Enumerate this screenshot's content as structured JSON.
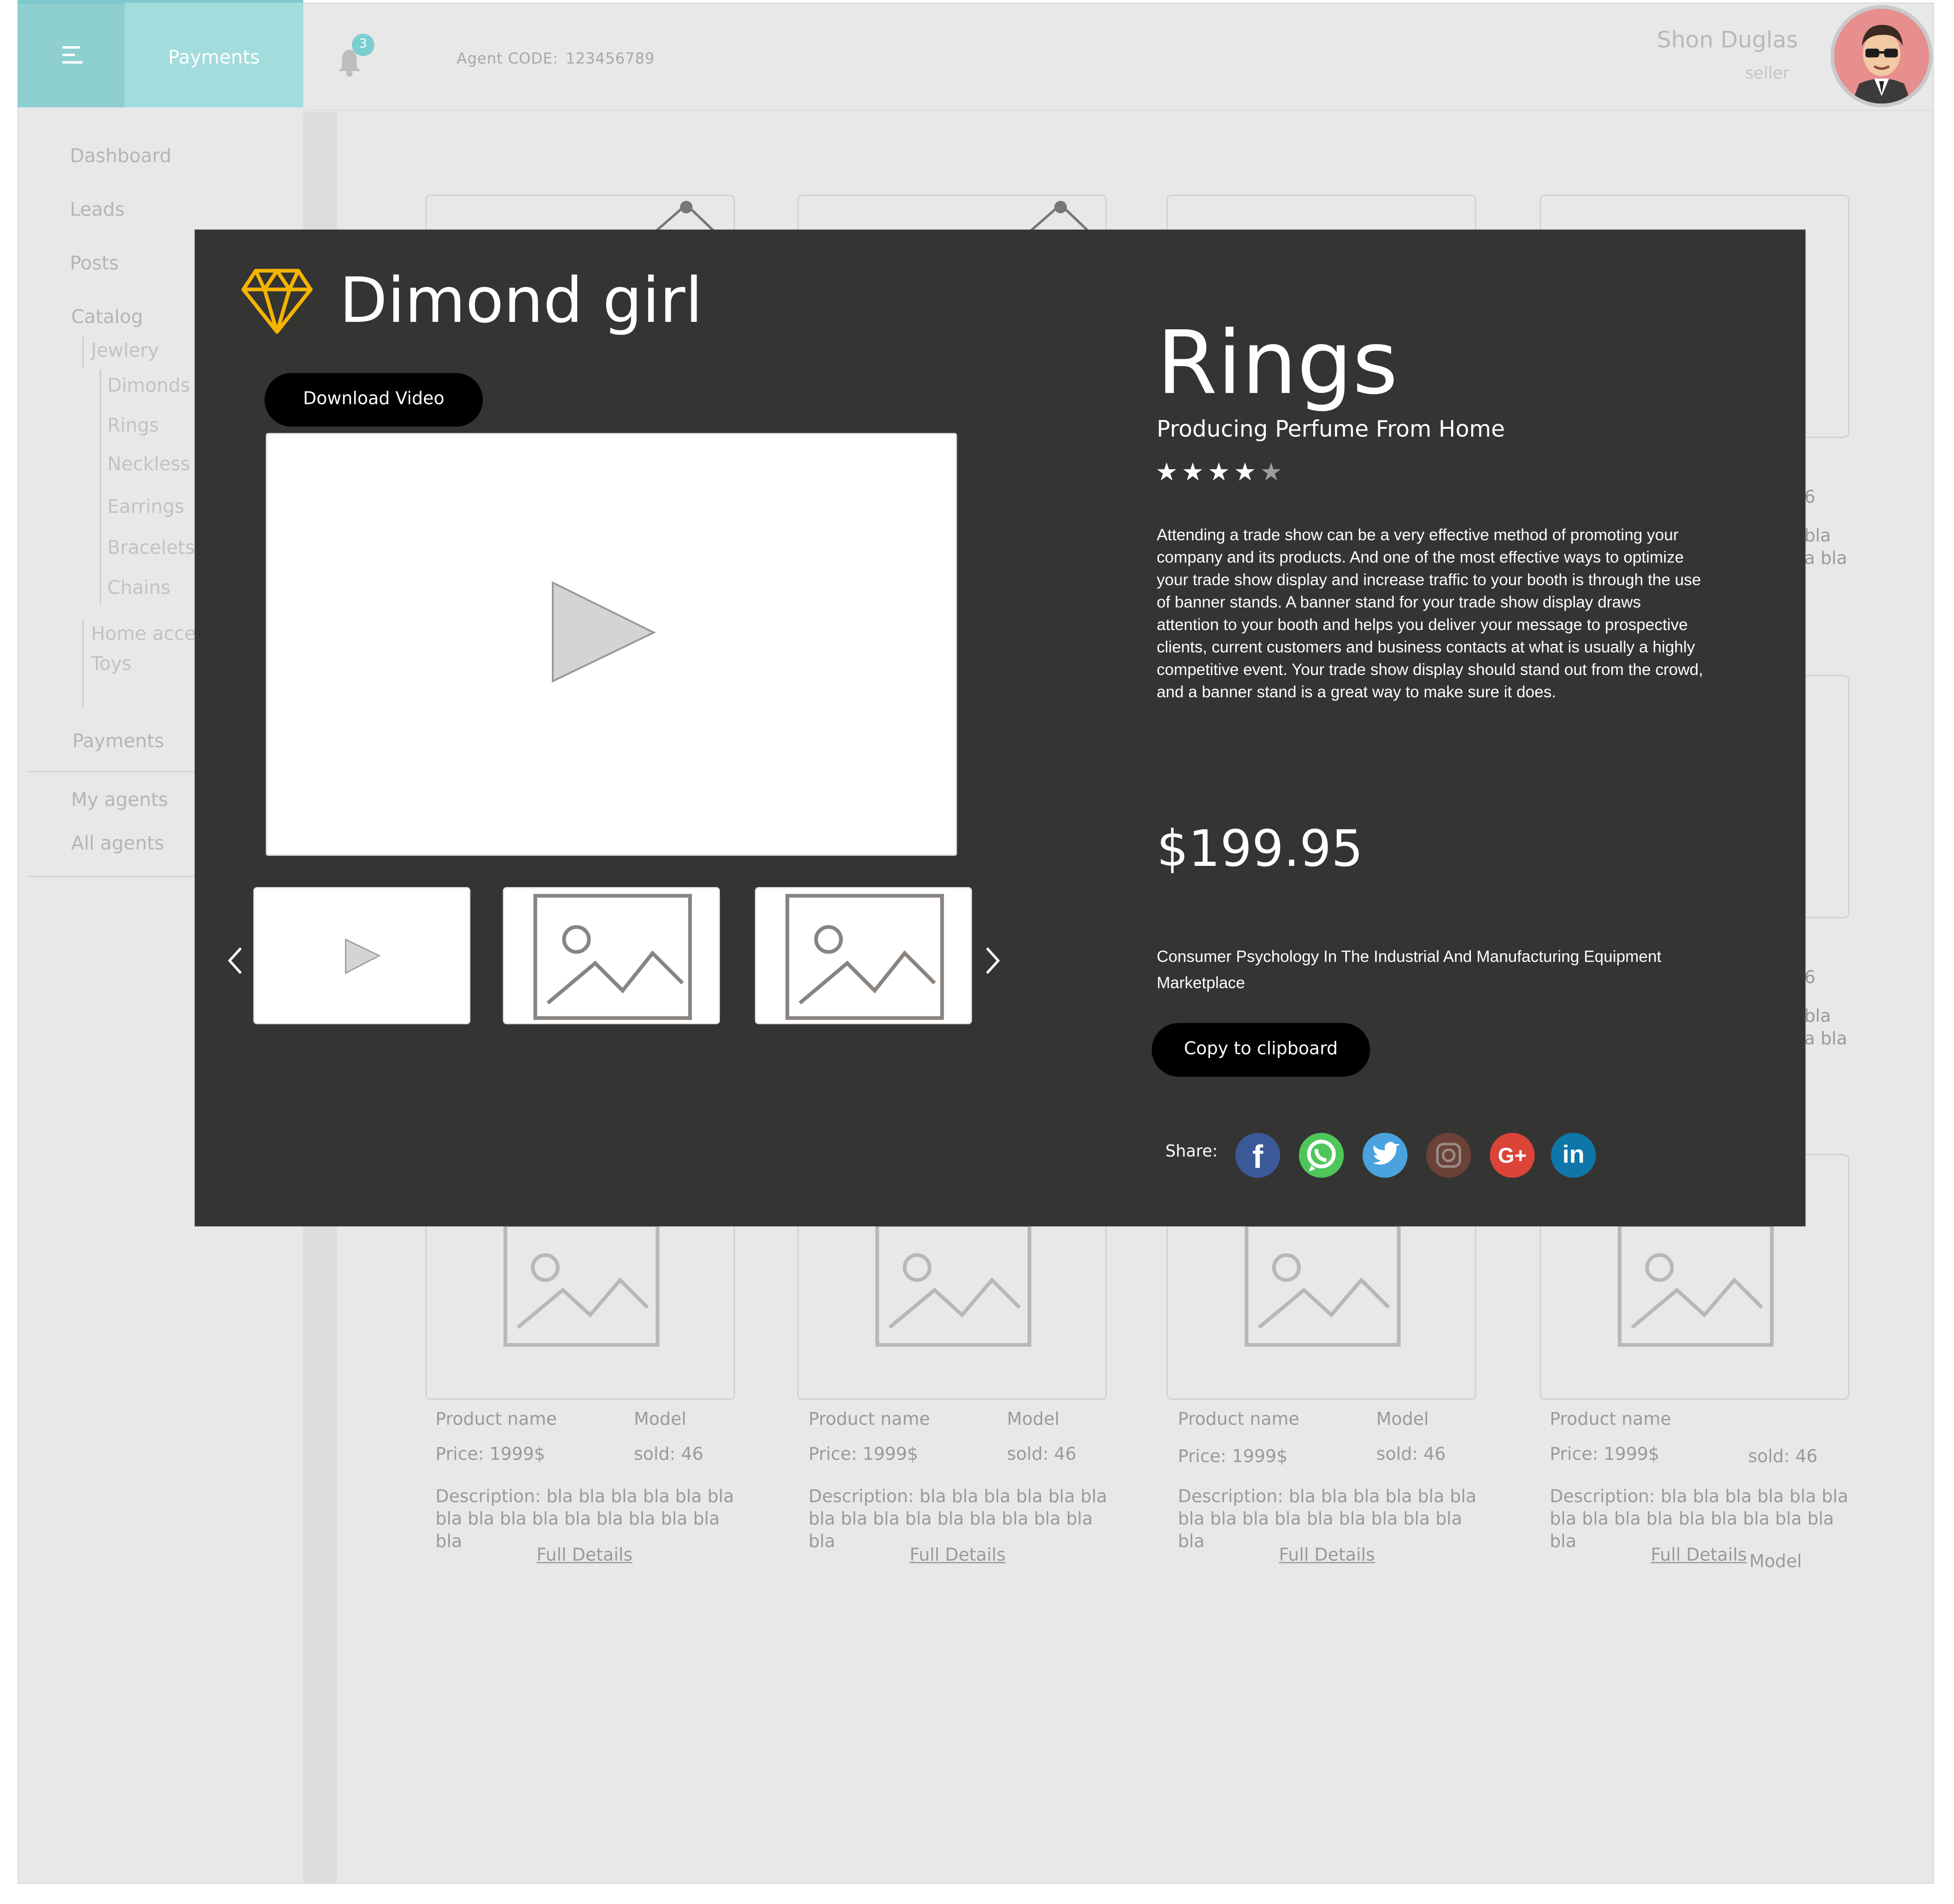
{
  "header": {
    "nav_label": "Payments",
    "notification_count": "3",
    "agent_label": "Agent  CODE:",
    "agent_code": "123456789",
    "user_name": "Shon Duglas",
    "user_role": "seller"
  },
  "sidebar": {
    "dashboard": "Dashboard",
    "leads": "Leads",
    "posts": "Posts",
    "catalog": "Catalog",
    "jewelry": "Jewlery",
    "dimonds": "Dimonds",
    "rings": "Rings",
    "neckless": "Neckless",
    "earrings": "Earrings",
    "bracelets": "Bracelets",
    "chains": "Chains",
    "home_acc": "Home acce",
    "toys": "Toys",
    "payments": "Payments",
    "my_agents": "My agents",
    "all_agents": "All agents"
  },
  "grid": {
    "partial_sold": "6",
    "partial_bla1": "bla",
    "partial_bla2": "a bla",
    "cards": [
      {
        "name": "Product name",
        "model": "Model",
        "price": "Price: 1999$",
        "sold": "sold: 46",
        "desc": "Description: bla bla bla bla bla bla bla bla bla bla bla bla bla bla bla bla",
        "link": "Full Details"
      },
      {
        "name": "Product name",
        "model": "Model",
        "price": "Price: 1999$",
        "sold": "sold: 46",
        "desc": "Description: bla bla bla bla bla bla bla bla bla bla bla bla bla bla bla bla",
        "link": "Full Details"
      },
      {
        "name": "Product name",
        "model": "Model",
        "price": "Price: 1999$",
        "sold": "sold: 46",
        "desc": "Description: bla bla bla bla bla bla bla bla bla bla bla bla bla bla bla bla",
        "link": "Full Details"
      },
      {
        "name": "Product name",
        "model": "Model",
        "price": "Price: 1999$",
        "sold": "sold: 46",
        "desc": "Description: bla bla bla bla bla bla bla bla bla bla bla bla bla bla bla bla",
        "link": "Full Details"
      }
    ]
  },
  "modal": {
    "title": "Dimond girl",
    "download_label": "Download Video",
    "product_title": "Rings",
    "subtitle": "Producing Perfume From Home",
    "rating": 4,
    "rating_max": 5,
    "description": "Attending a trade show can be a very effective method of promoting your company and its products. And one of the most effective ways to optimize your trade show display and increase traffic to your booth is through the use of banner stands. A banner stand for your trade show display draws attention to your booth and helps you deliver your message to prospective clients, current customers and business contacts at what is usually a highly competitive event. Your trade show display should stand out from the crowd, and a banner stand is a great way to make sure it does.",
    "price": "$199.95",
    "consumer_text": "Consumer Psychology In The Industrial And Manufacturing Equipment Marketplace",
    "copy_label": "Copy to clipboard",
    "share_label": "Share:",
    "social": [
      "facebook-icon",
      "whatsapp-icon",
      "twitter-icon",
      "instagram-icon",
      "google-plus-icon",
      "linkedin-icon"
    ]
  },
  "colors": {
    "header_accent": "#8ecfcf",
    "header_tab": "#a3dcdc",
    "modal_bg": "#343433",
    "gem": "#f4b400",
    "facebook": "#3b5998",
    "whatsapp": "#4fc65a",
    "twitter": "#4aa3df",
    "instagram": "#6b4138",
    "google_plus": "#db4437",
    "linkedin": "#0e76a8"
  }
}
